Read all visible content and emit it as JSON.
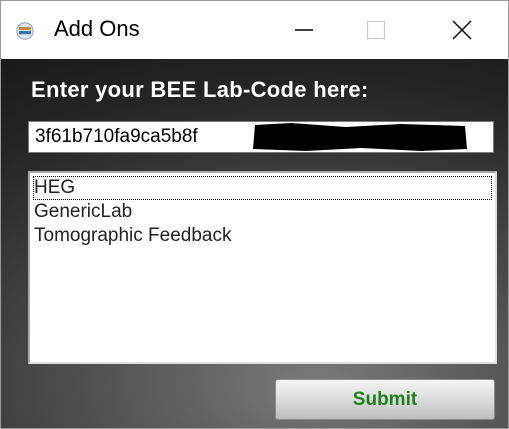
{
  "window": {
    "title": "Add Ons",
    "icon": "app-icon",
    "controls": {
      "minimize_icon": "minimize-icon",
      "maximize_icon": "maximize-icon",
      "close_icon": "close-icon",
      "maximize_enabled": false
    }
  },
  "form": {
    "heading": "Enter your BEE Lab-Code here:",
    "code_value": "3f61b710fa9ca5b8f",
    "code_redacted": true
  },
  "list": {
    "items": [
      {
        "label": "HEG",
        "focused": true
      },
      {
        "label": "GenericLab",
        "focused": false
      },
      {
        "label": "Tomographic Feedback",
        "focused": false
      }
    ]
  },
  "submit": {
    "label": "Submit"
  },
  "colors": {
    "submit_text": "#1f7f1f",
    "heading_text": "#ffffff",
    "background_dark": "#262626"
  }
}
